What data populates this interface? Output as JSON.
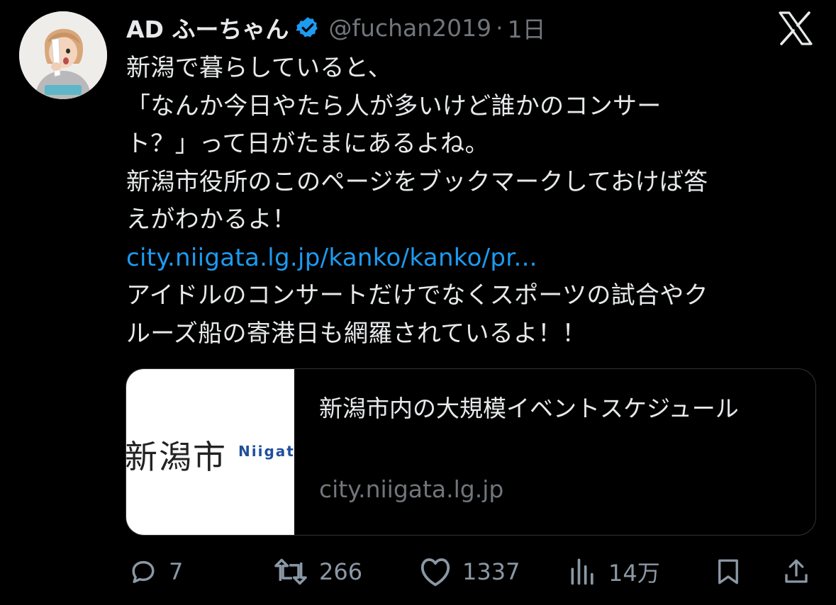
{
  "author": {
    "display_name": "AD ふーちゃん",
    "handle": "@fuchan2019",
    "separator": "·",
    "time": "1日"
  },
  "tweet": {
    "lines": [
      "新潟で暮らしていると、",
      "「なんか今日やたら人が多いけど誰かのコンサー",
      "ト？」って日がたまにあるよね。",
      "新潟市役所のこのページをブックマークしておけば答",
      "えがわかるよ！"
    ],
    "link": "city.niigata.lg.jp/kanko/kanko/pr...",
    "after_lines": [
      "アイドルのコンサートだけでなくスポーツの試合やク",
      "ルーズ船の寄港日も網羅されているよ！！"
    ]
  },
  "card": {
    "thumb_kanji": "新潟市",
    "thumb_roman": "Niigata",
    "title": "新潟市内の大規模イベントスケジュール",
    "domain": "city.niigata.lg.jp"
  },
  "actions": {
    "replies": "7",
    "reposts": "266",
    "likes": "1337",
    "views": "14万"
  },
  "colors": {
    "background": "#000000",
    "text": "#e7e9ea",
    "secondary": "#71767b",
    "link": "#1d9bf0",
    "verified": "#1d9bf0"
  }
}
